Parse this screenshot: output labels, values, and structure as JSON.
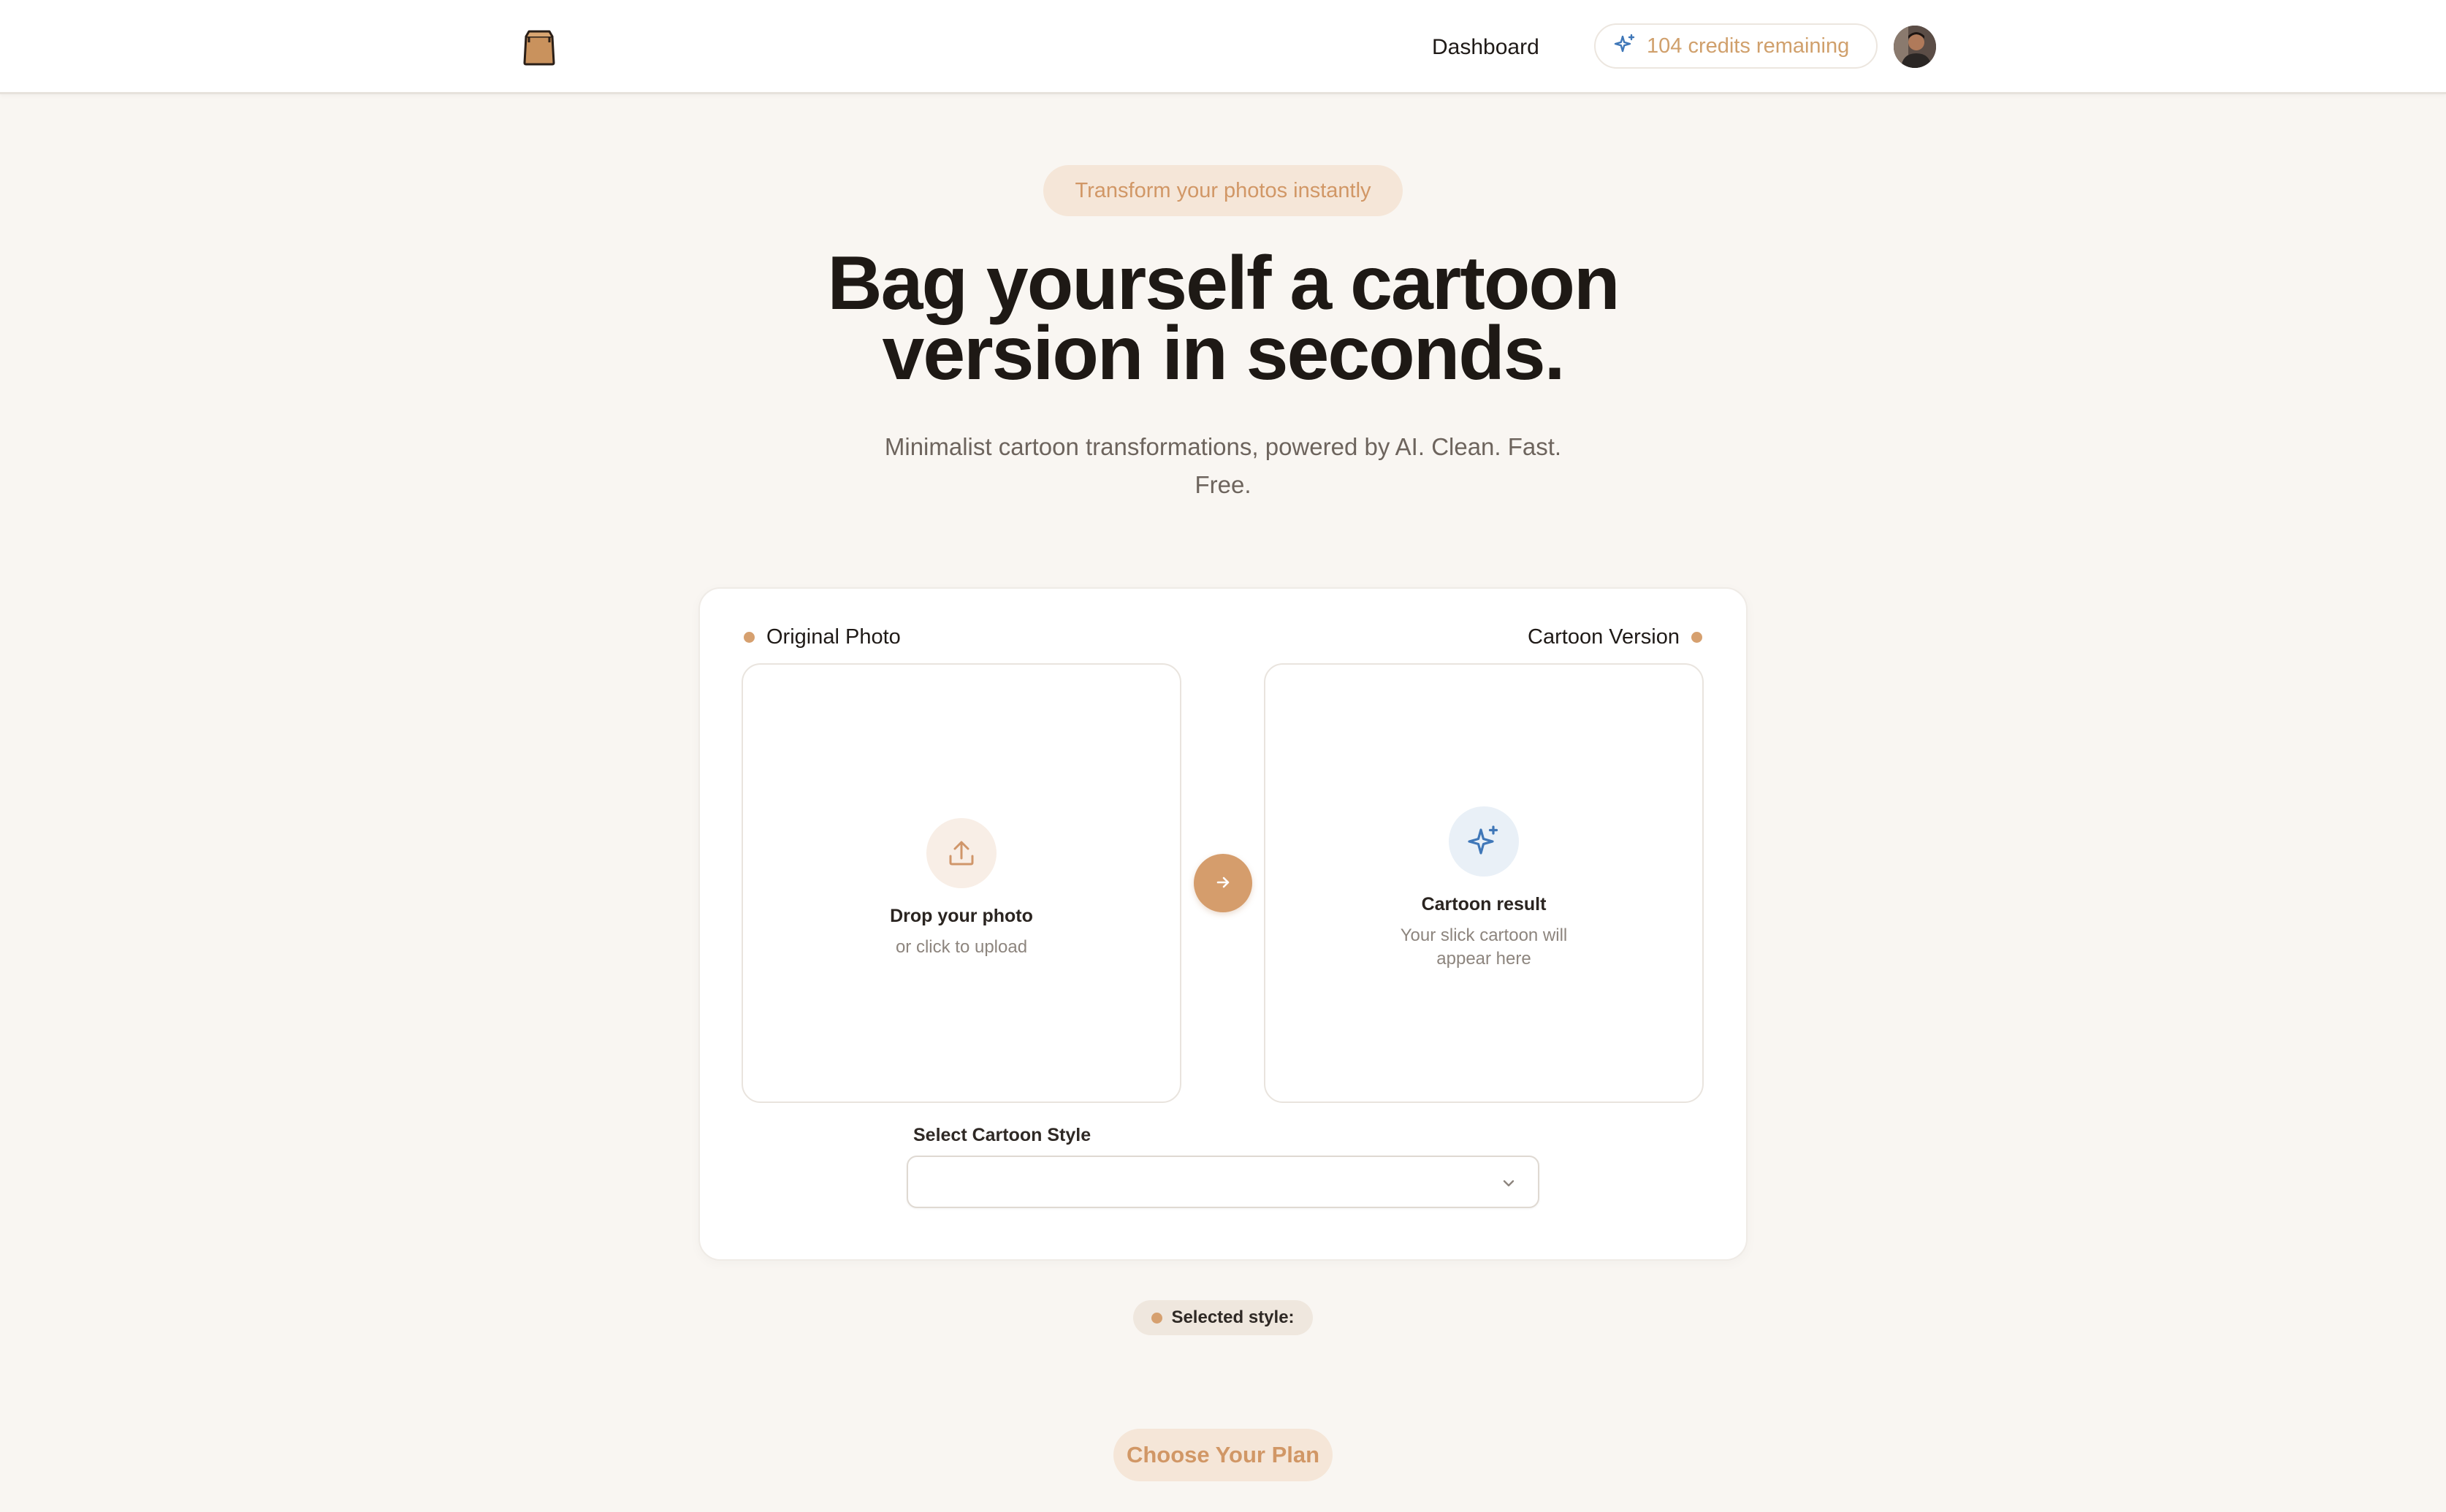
{
  "header": {
    "nav_dashboard": "Dashboard",
    "credits_label": "104 credits remaining",
    "logo_icon": "paper-bag-icon",
    "avatar": "user-avatar"
  },
  "hero": {
    "eyebrow": "Transform your photos instantly",
    "title_line1": "Bag yourself a cartoon",
    "title_line2": "version in seconds.",
    "subtitle": "Minimalist cartoon transformations, powered by AI. Clean. Fast. Free."
  },
  "converter": {
    "left_label": "Original Photo",
    "right_label": "Cartoon Version",
    "upload": {
      "icon": "upload-icon",
      "title": "Drop your photo",
      "subtitle": "or click to upload"
    },
    "result": {
      "icon": "sparkle-icon",
      "title": "Cartoon result",
      "subtitle": "Your slick cartoon will appear here"
    },
    "arrow_icon": "arrow-right-icon",
    "style_label": "Select Cartoon Style",
    "style_value": "",
    "style_chevron_icon": "chevron-down-icon"
  },
  "selected_style_label": "Selected style:",
  "plan_button": "Choose Your Plan",
  "colors": {
    "accent": "#d59d6c",
    "accent_text": "#d19766",
    "page_bg": "#f9f6f2",
    "sparkle_blue": "#3f77b8"
  }
}
